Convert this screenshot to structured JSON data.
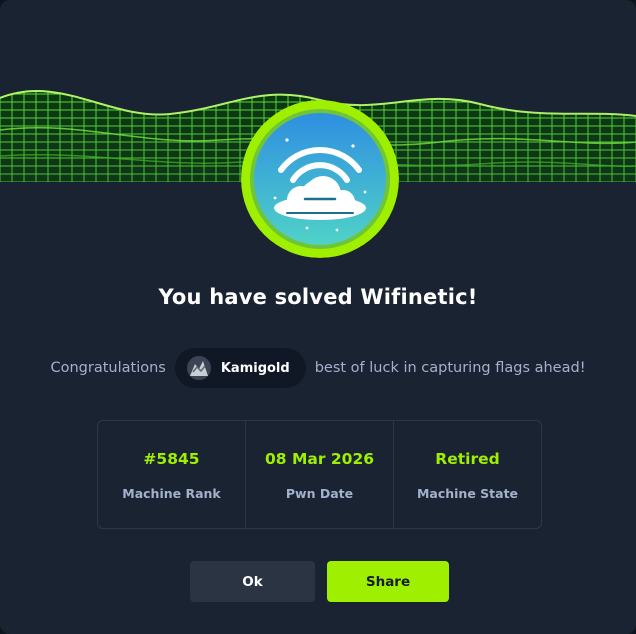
{
  "modal": {
    "title": "You have solved Wifinetic!",
    "congrats_prefix": "Congratulations",
    "user_name": "Kamigold",
    "congrats_suffix": "best of luck in capturing flags ahead!",
    "stats": [
      {
        "value": "#5845",
        "label": "Machine Rank"
      },
      {
        "value": "08 Mar 2026",
        "label": "Pwn Date"
      },
      {
        "value": "Retired",
        "label": "Machine State"
      }
    ],
    "buttons": {
      "ok": "Ok",
      "share": "Share"
    }
  },
  "icons": {
    "badge": "wifi-cloud-machine-icon",
    "banner": "green-cube-wave-graphic",
    "avatar": "user-avatar-image"
  },
  "colors": {
    "accent": "#9fef00",
    "background": "#1a2332",
    "muted_text": "#a4b1cd",
    "ok_button": "#2a3443"
  }
}
